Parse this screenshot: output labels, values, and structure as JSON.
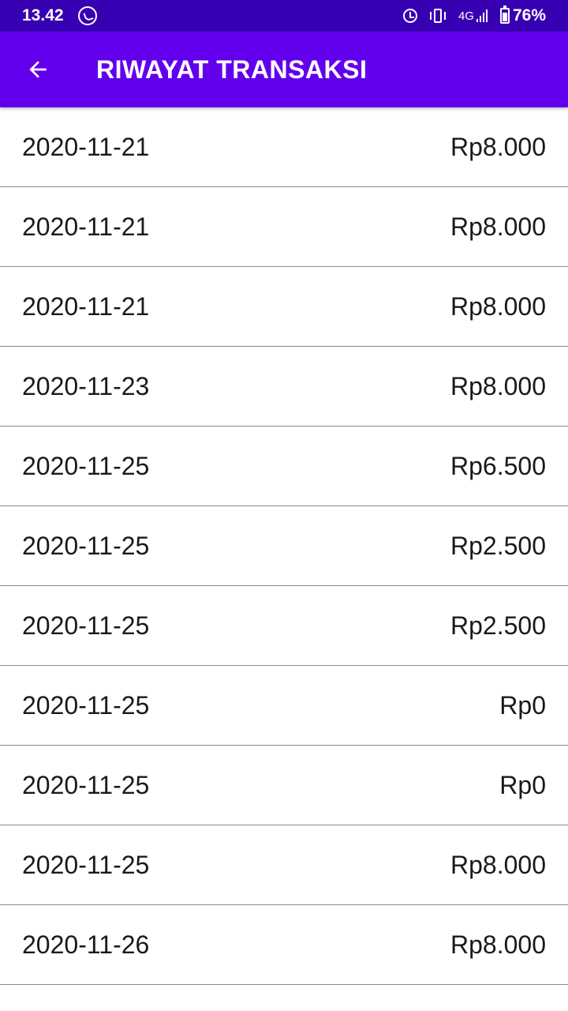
{
  "status_bar": {
    "time": "13.42",
    "network": "4G",
    "battery": "76%",
    "icons": [
      "whatsapp-icon",
      "alarm-icon",
      "vibrate-icon",
      "signal-icon",
      "battery-icon"
    ]
  },
  "app_bar": {
    "title": "RIWAYAT TRANSAKSI",
    "back_icon": "arrow-back-icon",
    "color": "#6200EE",
    "status_color": "#3700B3"
  },
  "transactions": [
    {
      "date": "2020-11-21",
      "amount": "Rp8.000"
    },
    {
      "date": "2020-11-21",
      "amount": "Rp8.000"
    },
    {
      "date": "2020-11-21",
      "amount": "Rp8.000"
    },
    {
      "date": "2020-11-23",
      "amount": "Rp8.000"
    },
    {
      "date": "2020-11-25",
      "amount": "Rp6.500"
    },
    {
      "date": "2020-11-25",
      "amount": "Rp2.500"
    },
    {
      "date": "2020-11-25",
      "amount": "Rp2.500"
    },
    {
      "date": "2020-11-25",
      "amount": "Rp0"
    },
    {
      "date": "2020-11-25",
      "amount": "Rp0"
    },
    {
      "date": "2020-11-25",
      "amount": "Rp8.000"
    },
    {
      "date": "2020-11-26",
      "amount": "Rp8.000"
    }
  ]
}
